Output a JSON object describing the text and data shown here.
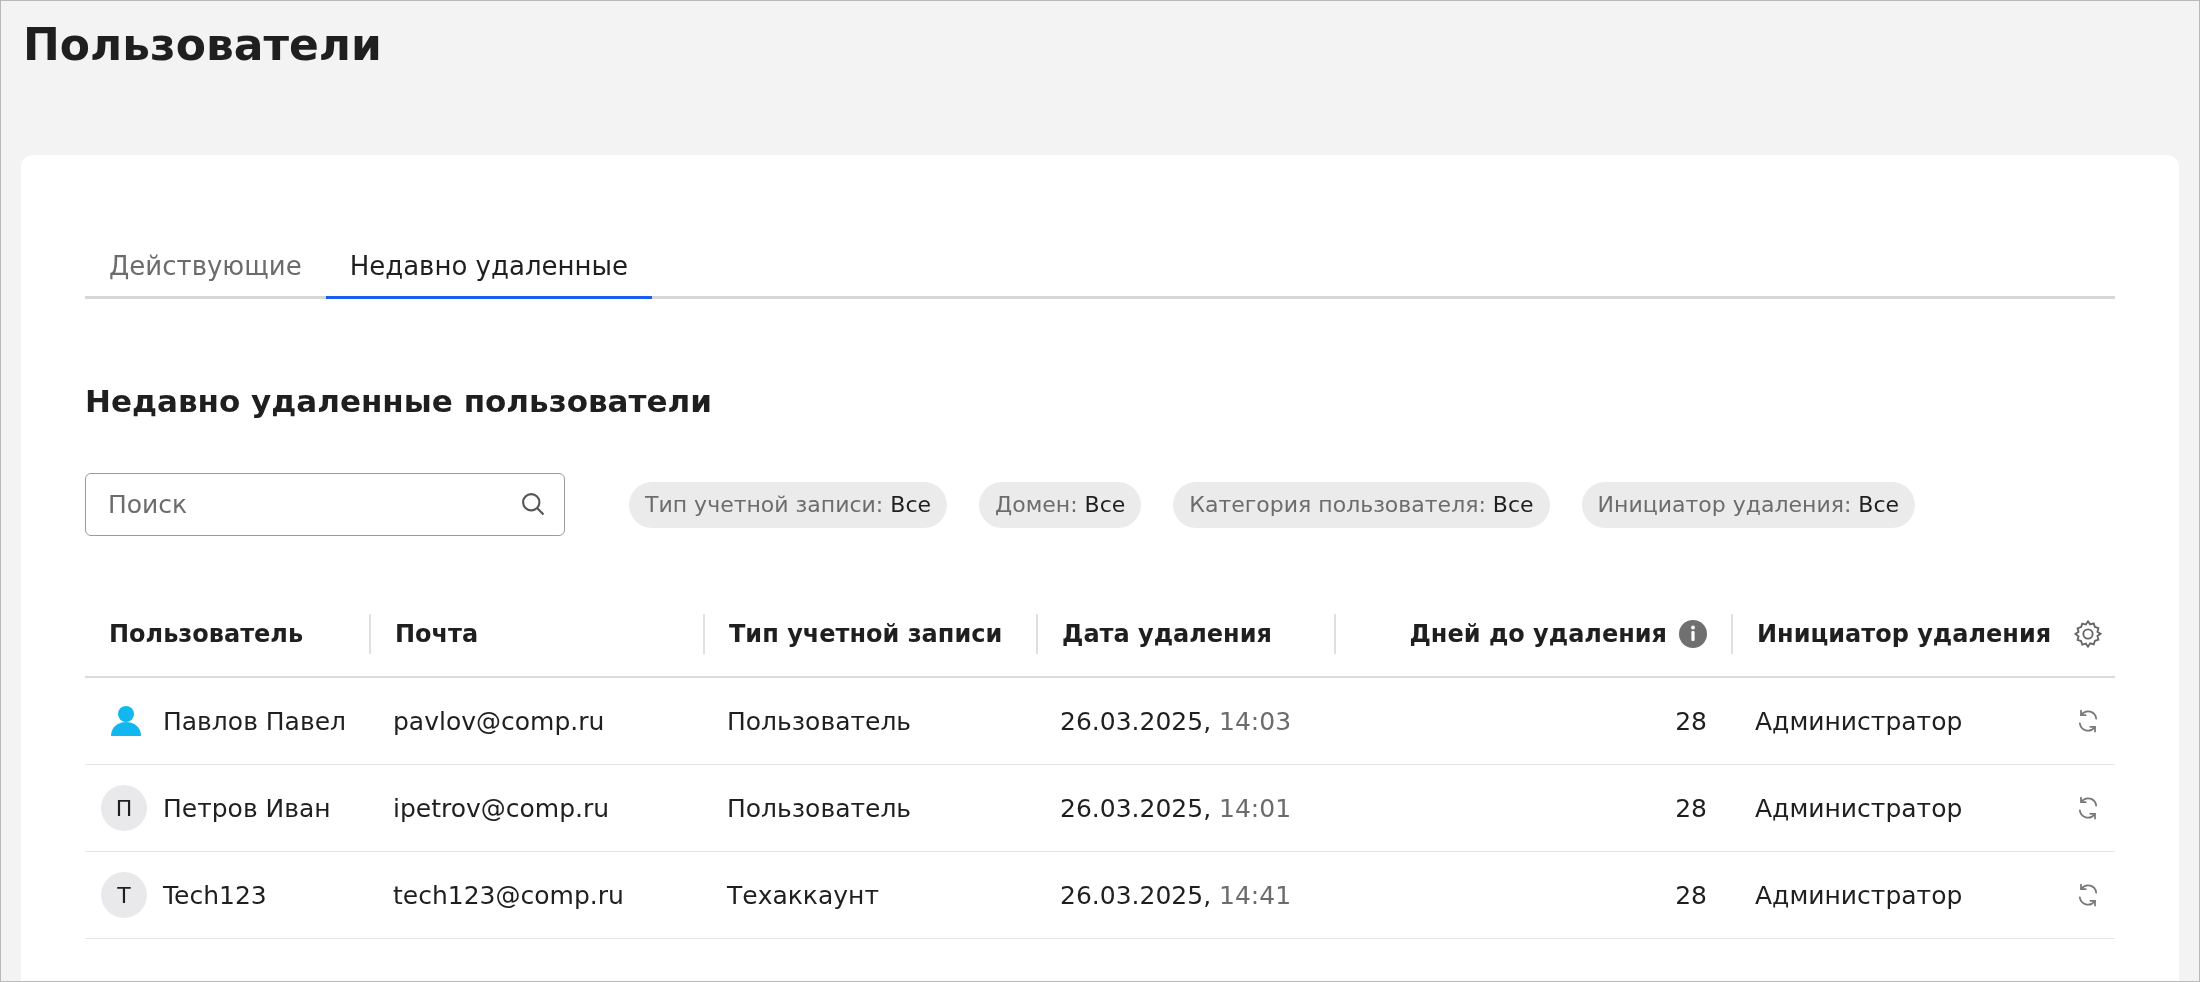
{
  "page_title": "Пользователи",
  "tabs": [
    {
      "label": "Действующие",
      "selected": false
    },
    {
      "label": "Недавно удаленные",
      "selected": true
    }
  ],
  "section_title": "Недавно удаленные пользователи",
  "search": {
    "placeholder": "Поиск"
  },
  "filters": [
    {
      "label": "Тип учетной записи:",
      "value": "Все"
    },
    {
      "label": "Домен:",
      "value": "Все"
    },
    {
      "label": "Категория пользователя:",
      "value": "Все"
    },
    {
      "label": "Инициатор удаления:",
      "value": "Все"
    }
  ],
  "table": {
    "columns": [
      {
        "label": "Пользователь",
        "info": false
      },
      {
        "label": "Почта",
        "info": false
      },
      {
        "label": "Тип учетной записи",
        "info": false
      },
      {
        "label": "Дата удаления",
        "info": false
      },
      {
        "label": "Дней до удаления",
        "info": true
      },
      {
        "label": "Инициатор удаления",
        "info": false
      }
    ],
    "rows": [
      {
        "avatar": {
          "kind": "photo"
        },
        "name": "Павлов Павел",
        "email": "pavlov@comp.ru",
        "account_type": "Пользователь",
        "date": "26.03.2025,",
        "time": "14:03",
        "days": "28",
        "initiator": "Администратор"
      },
      {
        "avatar": {
          "kind": "initial",
          "letter": "П"
        },
        "name": "Петров Иван",
        "email": "ipetrov@comp.ru",
        "account_type": "Пользователь",
        "date": "26.03.2025,",
        "time": "14:01",
        "days": "28",
        "initiator": "Администратор"
      },
      {
        "avatar": {
          "kind": "initial",
          "letter": "Т"
        },
        "name": "Tech123",
        "email": "tech123@comp.ru",
        "account_type": "Техаккаунт",
        "date": "26.03.2025,",
        "time": "14:41",
        "days": "28",
        "initiator": "Администратор"
      }
    ]
  }
}
